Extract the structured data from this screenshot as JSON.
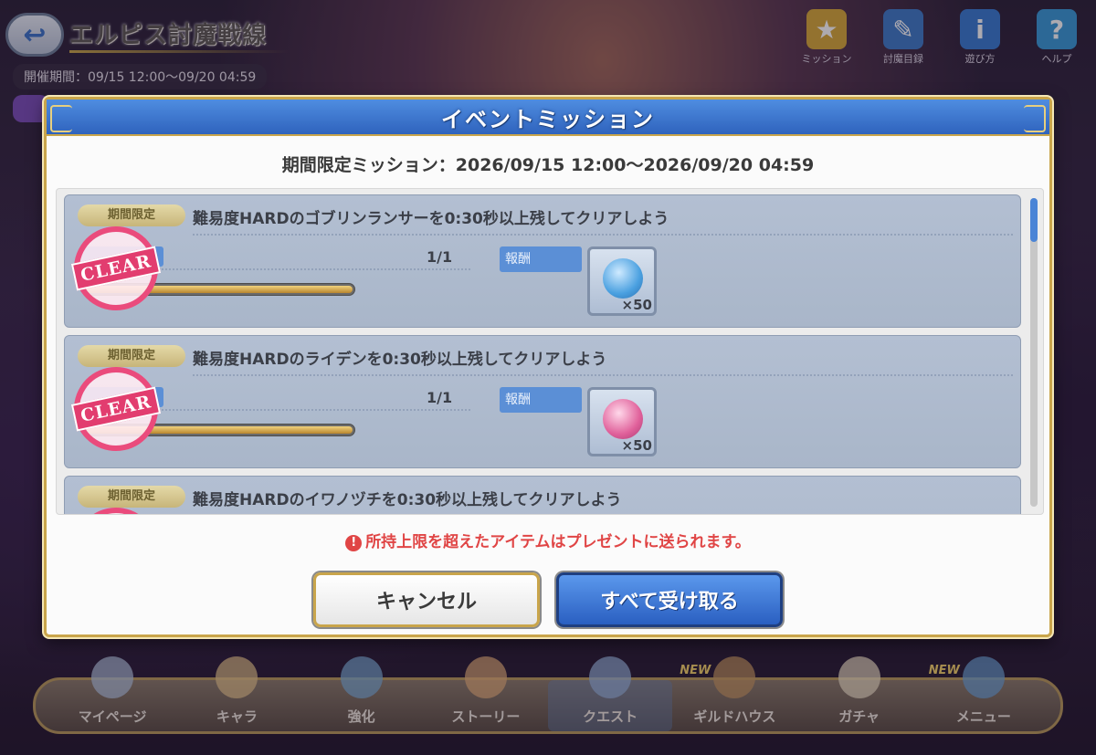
{
  "header": {
    "title": "エルピス討魔戦線",
    "period": "開催期間：09/15 12:00〜09/20 04:59"
  },
  "top_icons": [
    {
      "name": "mission-icon",
      "glyph": "★",
      "label": "ミッション",
      "color": "#d7a93a"
    },
    {
      "name": "map-icon",
      "glyph": "✎",
      "label": "討魔目録",
      "color": "#3f7bc8"
    },
    {
      "name": "info-icon",
      "glyph": "i",
      "label": "遊び方",
      "color": "#3a7cd2"
    },
    {
      "name": "help-icon",
      "glyph": "?",
      "label": "ヘルプ",
      "color": "#3a9ad8"
    }
  ],
  "modal": {
    "title": "イベントミッション",
    "period": "期間限定ミッション：2026/09/15 12:00〜2026/09/20 04:59",
    "missions": [
      {
        "tag": "期間限定",
        "title": "難易度HARDのゴブリンランサーを0:30秒以上残してクリアしよう",
        "progress": "1/1",
        "progress_fraction": 1.0,
        "status": "CLEAR",
        "reward_label": "報酬",
        "reward_qty": "×50",
        "reward_color": "#4aa0e0"
      },
      {
        "tag": "期間限定",
        "title": "難易度HARDのライデンを0:30秒以上残してクリアしよう",
        "progress": "1/1",
        "progress_fraction": 1.0,
        "status": "CLEAR",
        "reward_label": "報酬",
        "reward_qty": "×50",
        "reward_color": "#e0609a"
      },
      {
        "tag": "期間限定",
        "title": "難易度HARDのイワノヅチを0:30秒以上残してクリアしよう"
      }
    ],
    "warning": "所持上限を超えたアイテムはプレゼントに送られます。",
    "warning_icon": "!",
    "cancel_label": "キャンセル",
    "receive_all_label": "すべて受け取る"
  },
  "bottom_nav": [
    {
      "label": "マイページ",
      "new": ""
    },
    {
      "label": "キャラ",
      "new": ""
    },
    {
      "label": "強化",
      "new": ""
    },
    {
      "label": "ストーリー",
      "new": ""
    },
    {
      "label": "クエスト",
      "new": "",
      "active": true
    },
    {
      "label": "ギルドハウス",
      "new": "NEW"
    },
    {
      "label": "ガチャ",
      "new": ""
    },
    {
      "label": "メニュー",
      "new": "NEW"
    }
  ]
}
